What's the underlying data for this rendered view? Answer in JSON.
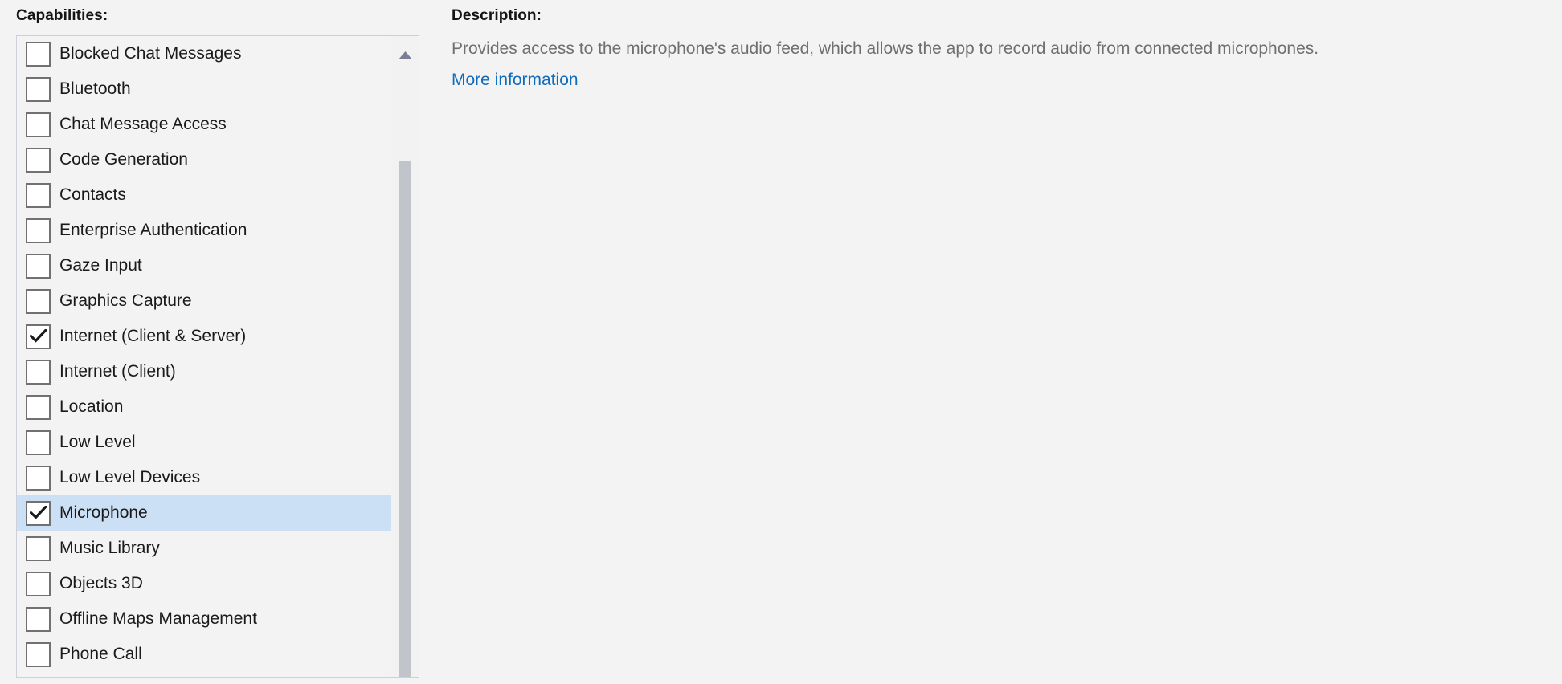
{
  "capabilities": {
    "label": "Capabilities:",
    "items": [
      {
        "label": "Blocked Chat Messages",
        "checked": false,
        "selected": false
      },
      {
        "label": "Bluetooth",
        "checked": false,
        "selected": false
      },
      {
        "label": "Chat Message Access",
        "checked": false,
        "selected": false
      },
      {
        "label": "Code Generation",
        "checked": false,
        "selected": false
      },
      {
        "label": "Contacts",
        "checked": false,
        "selected": false
      },
      {
        "label": "Enterprise Authentication",
        "checked": false,
        "selected": false
      },
      {
        "label": "Gaze Input",
        "checked": false,
        "selected": false
      },
      {
        "label": "Graphics Capture",
        "checked": false,
        "selected": false
      },
      {
        "label": "Internet (Client & Server)",
        "checked": true,
        "selected": false
      },
      {
        "label": "Internet (Client)",
        "checked": false,
        "selected": false
      },
      {
        "label": "Location",
        "checked": false,
        "selected": false
      },
      {
        "label": "Low Level",
        "checked": false,
        "selected": false
      },
      {
        "label": "Low Level Devices",
        "checked": false,
        "selected": false
      },
      {
        "label": "Microphone",
        "checked": true,
        "selected": true
      },
      {
        "label": "Music Library",
        "checked": false,
        "selected": false
      },
      {
        "label": "Objects 3D",
        "checked": false,
        "selected": false
      },
      {
        "label": "Offline Maps Management",
        "checked": false,
        "selected": false
      },
      {
        "label": "Phone Call",
        "checked": false,
        "selected": false
      }
    ],
    "scrollbar": {
      "up_arrow_icon": "chevron-up-icon"
    }
  },
  "description": {
    "label": "Description:",
    "body": "Provides access to the microphone's audio feed, which allows the app to record audio from connected microphones.",
    "link_label": "More information"
  },
  "colors": {
    "background": "#f3f3f3",
    "selection": "#cce0f5",
    "link": "#0f6cbd",
    "body_text": "#6f6f6f",
    "heading_text": "#141414",
    "listbox_border": "#ccd0da",
    "checkbox_border": "#717171",
    "scrollbar_thumb": "#c2c4cb"
  }
}
